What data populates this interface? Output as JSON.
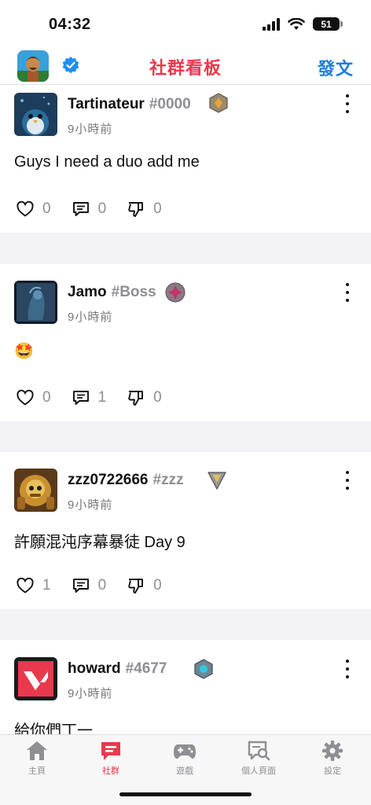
{
  "status": {
    "time": "04:32",
    "battery": "51"
  },
  "nav": {
    "title": "社群看板",
    "post_label": "發文"
  },
  "posts": [
    {
      "username": "Tartinateur",
      "tag": "#0000",
      "time": "9小時前",
      "content": "Guys I need a duo add me",
      "likes": "0",
      "comments": "0",
      "dislikes": "0"
    },
    {
      "username": "Jamo",
      "tag": "#Boss",
      "time": "9小時前",
      "content": "🤩",
      "likes": "0",
      "comments": "1",
      "dislikes": "0"
    },
    {
      "username": "zzz0722666",
      "tag": "#zzz",
      "time": "9小時前",
      "content": "許願混沌序幕暴徒 Day 9",
      "likes": "1",
      "comments": "0",
      "dislikes": "0"
    },
    {
      "username": "howard",
      "tag": "#4677",
      "time": "9小時前",
      "content": "給你們丁一"
    }
  ],
  "tabs": [
    {
      "label": "主頁"
    },
    {
      "label": "社群"
    },
    {
      "label": "遊戲"
    },
    {
      "label": "個人頁面"
    },
    {
      "label": "設定"
    }
  ],
  "colors": {
    "accent": "#e8394d",
    "link": "#1a7de0",
    "muted": "#8e8e93"
  }
}
